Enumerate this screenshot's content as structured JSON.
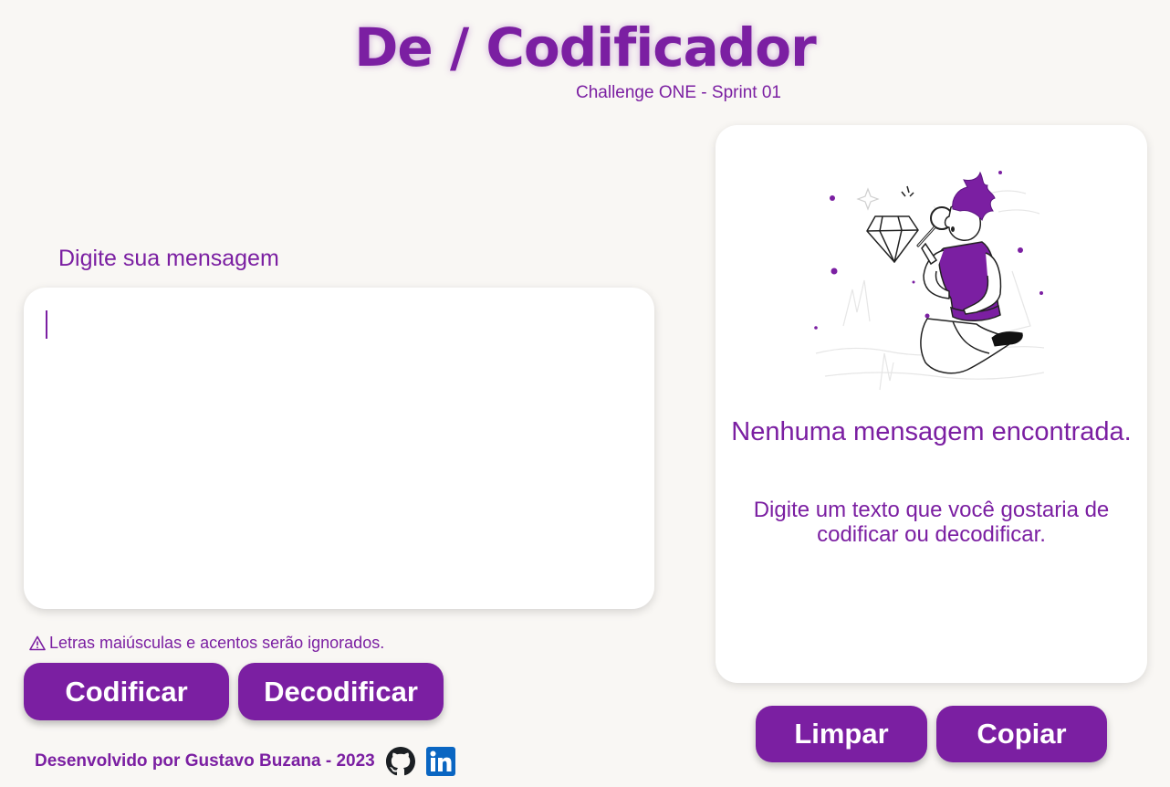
{
  "header": {
    "title": "De / Codificador",
    "subtitle": "Challenge ONE - Sprint 01"
  },
  "input": {
    "label": "Digite sua mensagem",
    "value": "",
    "placeholder": ""
  },
  "warning": {
    "icon": "warning-icon",
    "text": "Letras maiúsculas e acentos serão ignorados."
  },
  "actions": {
    "encode_label": "Codificar",
    "decode_label": "Decodificar",
    "clear_label": "Limpar",
    "copy_label": "Copiar"
  },
  "output": {
    "title": "Nenhuma mensagem encontrada.",
    "text": "Digite um texto que você gostaria de codificar ou decodificar.",
    "illustration": "person-inspecting-diamond-illustration"
  },
  "footer": {
    "credit": "Desenvolvido por Gustavo Buzana - 2023",
    "github_icon": "github-icon",
    "linkedin_icon": "linkedin-icon"
  },
  "colors": {
    "accent": "#7b1fa2",
    "background": "#f9f7f4",
    "card": "#ffffff",
    "linkedin": "#0a66c2"
  }
}
